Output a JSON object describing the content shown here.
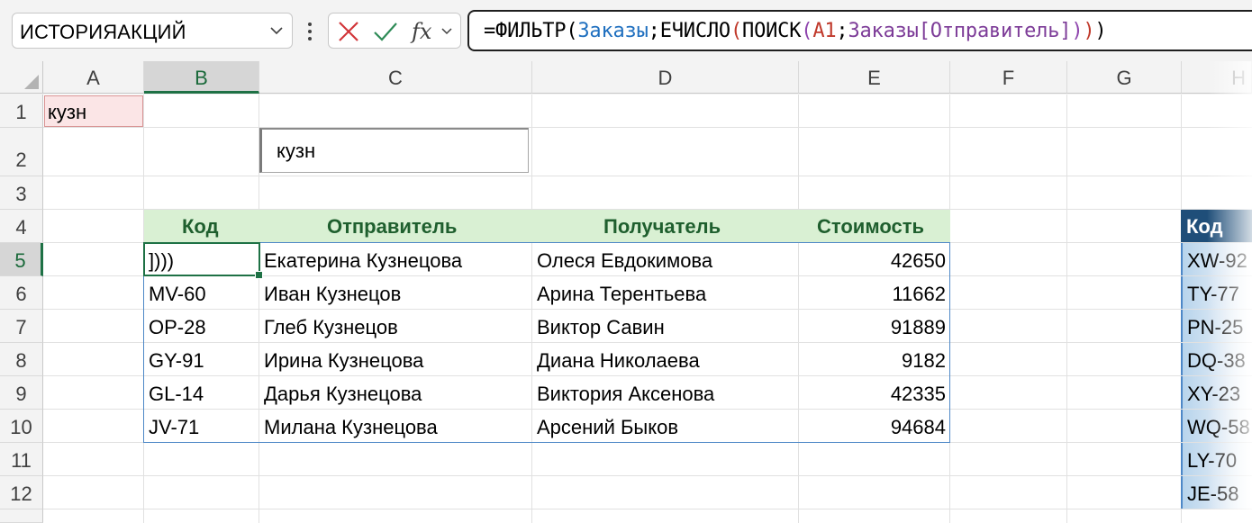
{
  "name_box": {
    "value": "ИСТОРИЯАКЦИЙ"
  },
  "formula_bar": {
    "formula_parts": [
      {
        "text": "=ФИЛЬТР(",
        "color": "#000000"
      },
      {
        "text": "Заказы",
        "color": "#1f6fbf"
      },
      {
        "text": ";ЕЧИСЛО",
        "color": "#000000"
      },
      {
        "text": "(",
        "color": "#c0392b"
      },
      {
        "text": "ПОИСК",
        "color": "#000000"
      },
      {
        "text": "(",
        "color": "#8e44ad"
      },
      {
        "text": "A1",
        "color": "#c0392b"
      },
      {
        "text": ";",
        "color": "#000000"
      },
      {
        "text": "Заказы[Отправитель]",
        "color": "#7d3c98"
      },
      {
        "text": ")",
        "color": "#8e44ad"
      },
      {
        "text": ")",
        "color": "#c0392b"
      },
      {
        "text": ")",
        "color": "#000000"
      }
    ],
    "cancel_icon": "close-icon",
    "enter_icon": "check-icon",
    "function_icon": "fx",
    "accent_colors": {
      "cancel": "#d13438",
      "enter": "#2e8b57"
    }
  },
  "columns": [
    "A",
    "B",
    "C",
    "D",
    "E",
    "F",
    "G",
    "H"
  ],
  "selected_column": "B",
  "rows": [
    "1",
    "2",
    "3",
    "4",
    "5",
    "6",
    "7",
    "8",
    "9",
    "10",
    "11",
    "12"
  ],
  "selected_row": "5",
  "cells": {
    "A1": "кузн",
    "search_box": "кузн"
  },
  "result_table": {
    "headers": [
      "Код",
      "Отправитель",
      "Получатель",
      "Стоимость"
    ],
    "rows": [
      [
        "]))) ",
        "Екатерина Кузнецова",
        "Олеся Евдокимова",
        "42650"
      ],
      [
        "MV-60",
        "Иван Кузнецов",
        "Арина Терентьева",
        "11662"
      ],
      [
        "OP-28",
        "Глеб Кузнецов",
        "Виктор Савин",
        "91889"
      ],
      [
        "GY-91",
        "Ирина Кузнецова",
        "Диана Николаева",
        "9182"
      ],
      [
        "GL-14",
        "Дарья Кузнецова",
        "Виктория Аксенова",
        "42335"
      ],
      [
        "JV-71",
        "Милана Кузнецова",
        "Арсений Быков",
        "94684"
      ]
    ],
    "header_color": "#d9f0d3",
    "header_text_color": "#1f5f2e"
  },
  "orders_table": {
    "header": "Код",
    "codes": [
      "XW-92",
      "TY-77",
      "PN-25",
      "DQ-38",
      "XY-23",
      "WQ-58",
      "LY-70",
      "JE-58"
    ],
    "header_color": "#1f4e79"
  }
}
